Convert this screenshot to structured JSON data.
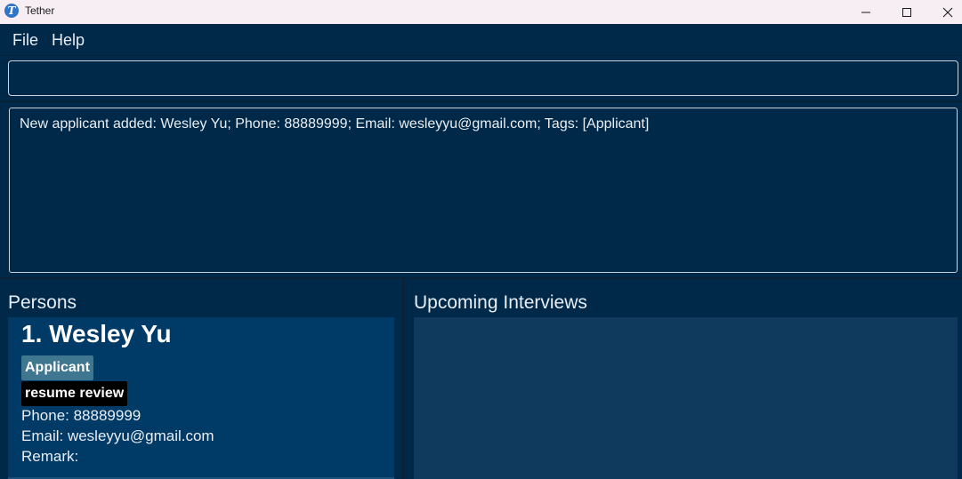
{
  "window": {
    "title": "Tether",
    "icon": "tether-app-icon",
    "icon_letter": "T"
  },
  "menu": {
    "items": [
      "File",
      "Help"
    ]
  },
  "command_box": {
    "value": "",
    "placeholder": ""
  },
  "result": {
    "message": "New applicant added: Wesley Yu; Phone: 88889999; Email: wesleyyu@gmail.com; Tags: [Applicant]"
  },
  "persons_panel": {
    "title": "Persons",
    "persons": [
      {
        "index_name": "1.  Wesley Yu",
        "tags": [
          "Applicant",
          "resume review"
        ],
        "phone_line": "Phone: 88889999",
        "email_line": "Email: wesleyyu@gmail.com",
        "remark_line": "Remark:"
      }
    ]
  },
  "interviews_panel": {
    "title": "Upcoming Interviews"
  },
  "colors": {
    "background": "#002949",
    "card": "#003a67",
    "applicant_tag": "#3f7690",
    "status_tag": "#000000",
    "interviews_bg": "#0f3a5e"
  }
}
